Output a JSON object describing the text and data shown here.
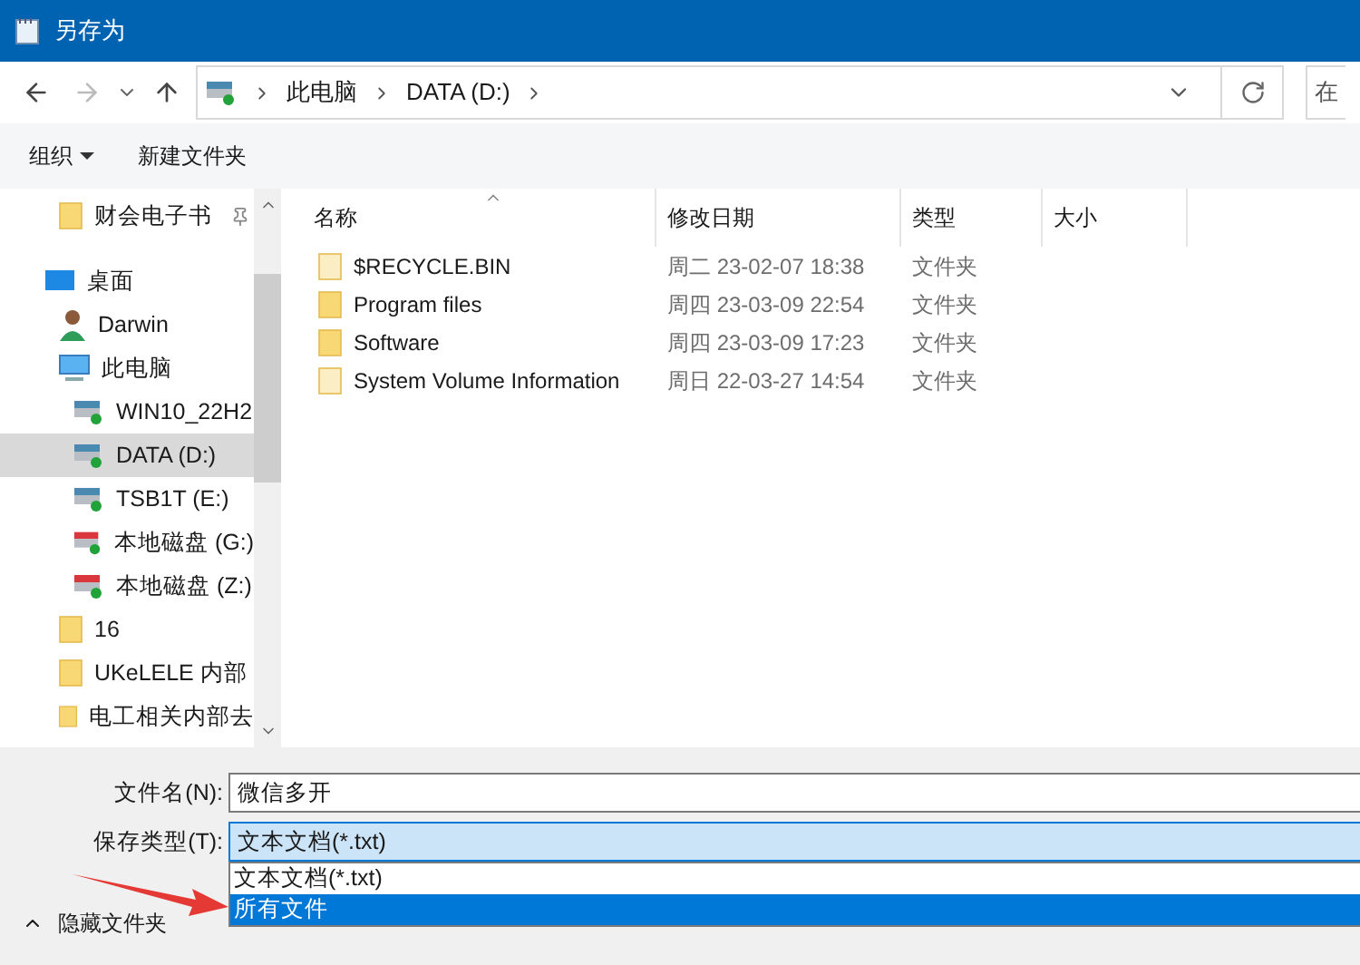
{
  "window": {
    "title": "另存为"
  },
  "address": {
    "crumbs": [
      "此电脑",
      "DATA (D:)"
    ],
    "search_placeholder": "在"
  },
  "toolbar": {
    "organize": "组织",
    "new_folder": "新建文件夹"
  },
  "sidebar": {
    "items": [
      {
        "kind": "pinned",
        "label": "财会电子书",
        "selected": false
      },
      {
        "kind": "desktop",
        "label": "桌面",
        "selected": false
      },
      {
        "kind": "user",
        "label": "Darwin",
        "selected": false
      },
      {
        "kind": "pc",
        "label": "此电脑",
        "selected": false
      },
      {
        "kind": "drive",
        "label": "WIN10_22H2",
        "selected": false
      },
      {
        "kind": "drive",
        "label": "DATA (D:)",
        "selected": true
      },
      {
        "kind": "drive",
        "label": "TSB1T (E:)",
        "selected": false
      },
      {
        "kind": "drive-red",
        "label": "本地磁盘 (G:)",
        "selected": false
      },
      {
        "kind": "drive-red",
        "label": "本地磁盘 (Z:)",
        "selected": false
      },
      {
        "kind": "folder",
        "label": "16",
        "selected": false
      },
      {
        "kind": "folder",
        "label": "UKeLELE 内部",
        "selected": false
      },
      {
        "kind": "folder",
        "label": "电工相关内部去",
        "selected": false
      }
    ]
  },
  "table": {
    "columns": [
      "名称",
      "修改日期",
      "类型",
      "大小"
    ],
    "rows": [
      {
        "name": "$RECYCLE.BIN",
        "date": "周二 23-02-07 18:38",
        "type": "文件夹",
        "hidden": true
      },
      {
        "name": "Program files",
        "date": "周四 23-03-09 22:54",
        "type": "文件夹",
        "hidden": false
      },
      {
        "name": "Software",
        "date": "周四 23-03-09 17:23",
        "type": "文件夹",
        "hidden": false
      },
      {
        "name": "System Volume Information",
        "date": "周日 22-03-27 14:54",
        "type": "文件夹",
        "hidden": true
      }
    ]
  },
  "form": {
    "filename_label": "文件名(N):",
    "filename": "微信多开",
    "type_label": "保存类型(T):",
    "type_value": "文本文档(*.txt)",
    "options": [
      {
        "label": "文本文档(*.txt)",
        "selected": false
      },
      {
        "label": "所有文件",
        "selected": true
      }
    ],
    "hide_folders": "隐藏文件夹"
  }
}
